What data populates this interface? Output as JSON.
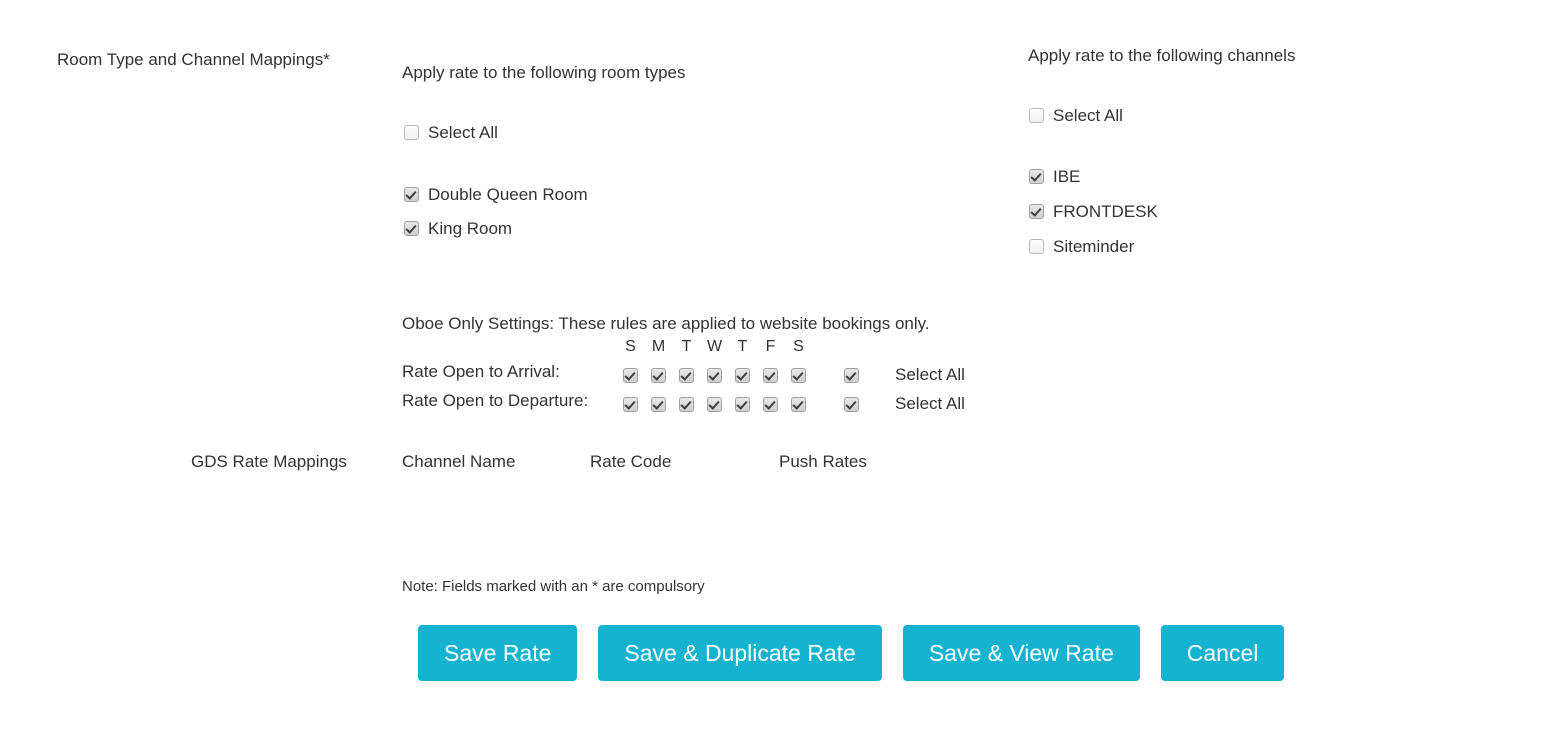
{
  "form": {
    "section_label": "Room Type and Channel Mappings*",
    "room_types": {
      "heading": "Apply rate to the following room types",
      "select_all": {
        "label": "Select All",
        "checked": false
      },
      "items": [
        {
          "label": "Double Queen Room",
          "checked": true
        },
        {
          "label": "King Room",
          "checked": true
        }
      ]
    },
    "channels": {
      "heading": "Apply rate to the following channels",
      "select_all": {
        "label": "Select All",
        "checked": false
      },
      "items": [
        {
          "label": "IBE",
          "checked": true
        },
        {
          "label": "FRONTDESK",
          "checked": true
        },
        {
          "label": "Siteminder",
          "checked": false
        }
      ]
    },
    "oboe": {
      "heading": "Oboe Only Settings: These rules are applied to website bookings only.",
      "day_headers": [
        "S",
        "M",
        "T",
        "W",
        "T",
        "F",
        "S"
      ],
      "rows": [
        {
          "label": "Rate Open to Arrival:",
          "days": [
            true,
            true,
            true,
            true,
            true,
            true,
            true
          ],
          "select_all_label": "Select All",
          "select_all_checked": true
        },
        {
          "label": "Rate Open to Departure:",
          "days": [
            true,
            true,
            true,
            true,
            true,
            true,
            true
          ],
          "select_all_label": "Select All",
          "select_all_checked": true
        }
      ]
    },
    "gds": {
      "section_label": "GDS Rate Mappings",
      "columns": [
        "Channel Name",
        "Rate Code",
        "Push Rates"
      ],
      "rows": []
    },
    "note": "Note: Fields marked with an * are compulsory",
    "buttons": [
      {
        "label": "Save Rate",
        "name": "save-rate-button"
      },
      {
        "label": "Save & Duplicate Rate",
        "name": "save-duplicate-rate-button"
      },
      {
        "label": "Save & View Rate",
        "name": "save-view-rate-button"
      },
      {
        "label": "Cancel",
        "name": "cancel-button"
      }
    ]
  },
  "theme": {
    "button_color": "#16b3d1",
    "text_color": "#333333",
    "background": "#ffffff"
  }
}
